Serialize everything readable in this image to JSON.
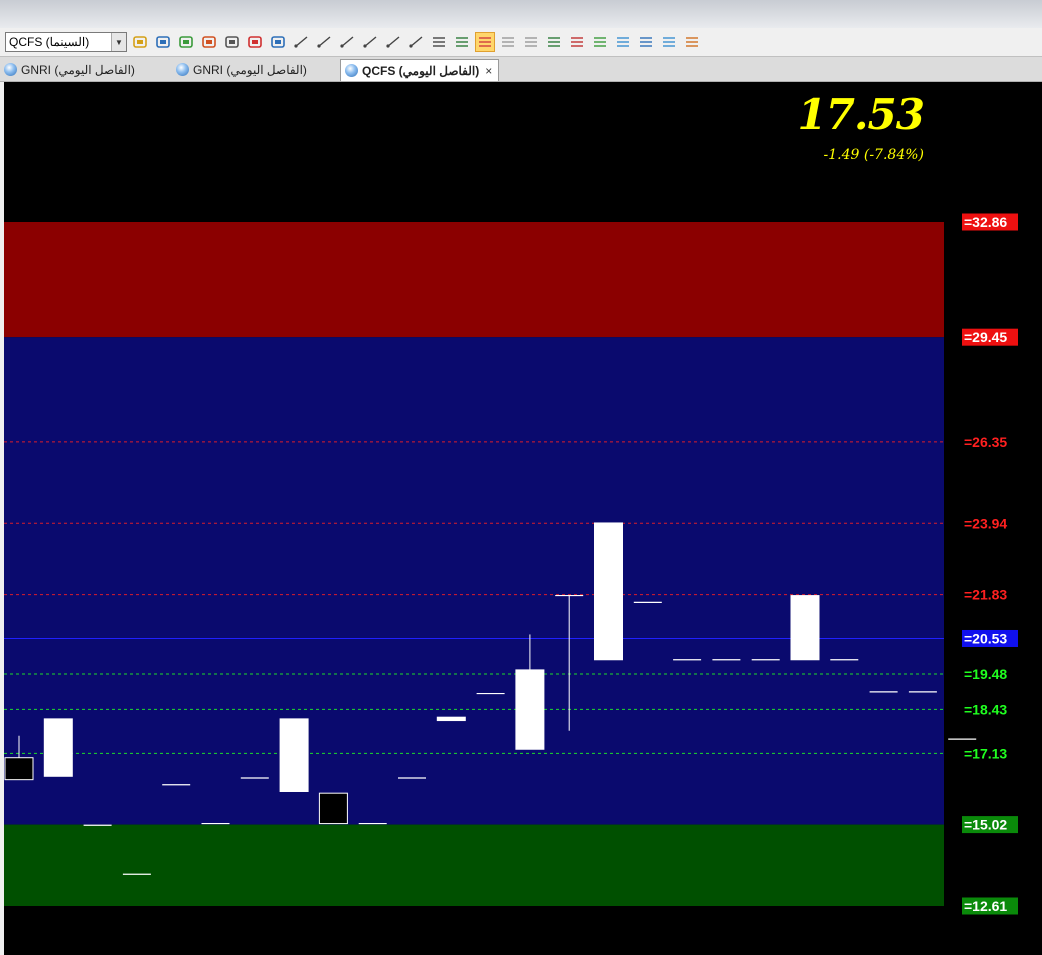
{
  "symbol_select": {
    "value": "QCFS (السينما)"
  },
  "toolbar_icons": [
    "wand-icon",
    "refresh-icon",
    "add-window-icon",
    "remove-window-icon",
    "network-icon",
    "stop-icon",
    "chart-type-icon",
    "draw-line-icon",
    "horizontal-line-icon",
    "vertical-line-icon",
    "trend-line-icon",
    "channel-icon",
    "parallel-lines-icon",
    "bars-icon",
    "levels-icon",
    "fibonacci-icon",
    "rectangle-icon",
    "copy-icon",
    "horizontal-bars-icon",
    "vertical-bars-icon",
    "angle-icon",
    "arc-icon",
    "grid-icon",
    "fan-icon",
    "flag-icon"
  ],
  "tabs": [
    {
      "label": "GNRI (الفاصل اليومي)",
      "active": false
    },
    {
      "label": "GNRI (الفاصل اليومي)",
      "active": false
    },
    {
      "label": "QCFS (الفاصل اليومي)",
      "active": true,
      "close": "×"
    }
  ],
  "quote": {
    "last": "17.53",
    "change": "-1.49  (-7.84%)"
  },
  "colors": {
    "red_zone": "#8b0000",
    "blue_zone": "#0a0a6e",
    "green_zone": "#005000",
    "price_text": "#ffff00",
    "label_red": "#ff2020",
    "label_green": "#20ff20",
    "label_blue": "#2020ff"
  },
  "chart_data": {
    "type": "candlestick",
    "ylim": [
      12.0,
      35.0
    ],
    "zones": [
      {
        "from": 29.45,
        "to": 32.86,
        "color": "#8b0000"
      },
      {
        "from": 15.02,
        "to": 29.45,
        "color": "#0a0a6e"
      },
      {
        "from": 12.61,
        "to": 15.02,
        "color": "#005000"
      }
    ],
    "levels": [
      {
        "value": 32.86,
        "label": "=32.86",
        "style": "box",
        "color": "#ff2020",
        "line": "none"
      },
      {
        "value": 29.45,
        "label": "=29.45",
        "style": "box",
        "color": "#ff2020",
        "line": "none"
      },
      {
        "value": 26.35,
        "label": "=26.35",
        "style": "text",
        "color": "#ff2020",
        "line": "dashed"
      },
      {
        "value": 23.94,
        "label": "=23.94",
        "style": "text",
        "color": "#ff2020",
        "line": "dashed"
      },
      {
        "value": 21.83,
        "label": "=21.83",
        "style": "text",
        "color": "#ff2020",
        "line": "dashed"
      },
      {
        "value": 20.53,
        "label": "=20.53",
        "style": "box",
        "color": "#2020ff",
        "line": "solid"
      },
      {
        "value": 19.48,
        "label": "=19.48",
        "style": "text",
        "color": "#20ff20",
        "line": "dashed"
      },
      {
        "value": 18.43,
        "label": "=18.43",
        "style": "text",
        "color": "#20ff20",
        "line": "dashed"
      },
      {
        "value": 17.13,
        "label": "=17.13",
        "style": "text",
        "color": "#20ff20",
        "line": "dashed"
      },
      {
        "value": 15.02,
        "label": "=15.02",
        "style": "box",
        "color": "#20ff20",
        "line": "none"
      },
      {
        "value": 12.61,
        "label": "=12.61",
        "style": "box",
        "color": "#20ff20",
        "line": "none"
      }
    ],
    "candles": [
      {
        "o": 17.0,
        "h": 17.65,
        "l": 16.35,
        "c": 16.35
      },
      {
        "o": 16.45,
        "h": 18.15,
        "l": 16.45,
        "c": 18.15
      },
      {
        "o": 15.0,
        "h": 15.0,
        "l": 15.0,
        "c": 15.0
      },
      {
        "o": 13.55,
        "h": 13.55,
        "l": 13.55,
        "c": 13.55
      },
      {
        "o": 16.2,
        "h": 16.2,
        "l": 16.2,
        "c": 16.2
      },
      {
        "o": 15.05,
        "h": 15.05,
        "l": 15.05,
        "c": 15.05
      },
      {
        "o": 16.4,
        "h": 16.4,
        "l": 16.4,
        "c": 16.4
      },
      {
        "o": 16.0,
        "h": 18.15,
        "l": 16.0,
        "c": 18.15
      },
      {
        "o": 15.95,
        "h": 15.95,
        "l": 15.05,
        "c": 15.05
      },
      {
        "o": 15.05,
        "h": 15.05,
        "l": 15.05,
        "c": 15.05
      },
      {
        "o": 16.4,
        "h": 16.4,
        "l": 16.4,
        "c": 16.4
      },
      {
        "o": 18.1,
        "h": 18.2,
        "l": 18.1,
        "c": 18.2
      },
      {
        "o": 18.9,
        "h": 18.9,
        "l": 18.9,
        "c": 18.9
      },
      {
        "o": 17.25,
        "h": 20.65,
        "l": 17.25,
        "c": 19.6
      },
      {
        "o": 21.8,
        "h": 21.8,
        "l": 17.8,
        "c": 21.8
      },
      {
        "o": 19.9,
        "h": 23.95,
        "l": 19.9,
        "c": 23.95
      },
      {
        "o": 21.6,
        "h": 21.6,
        "l": 21.6,
        "c": 21.6
      },
      {
        "o": 19.9,
        "h": 19.9,
        "l": 19.9,
        "c": 19.9
      },
      {
        "o": 19.9,
        "h": 19.9,
        "l": 19.9,
        "c": 19.9
      },
      {
        "o": 19.9,
        "h": 19.9,
        "l": 19.9,
        "c": 19.9
      },
      {
        "o": 19.9,
        "h": 21.8,
        "l": 19.9,
        "c": 21.8
      },
      {
        "o": 19.9,
        "h": 19.9,
        "l": 19.9,
        "c": 19.9
      },
      {
        "o": 18.95,
        "h": 18.95,
        "l": 18.95,
        "c": 18.95
      },
      {
        "o": 18.95,
        "h": 18.95,
        "l": 18.95,
        "c": 18.95
      },
      {
        "o": 17.55,
        "h": 17.55,
        "l": 17.55,
        "c": 17.55
      }
    ]
  }
}
